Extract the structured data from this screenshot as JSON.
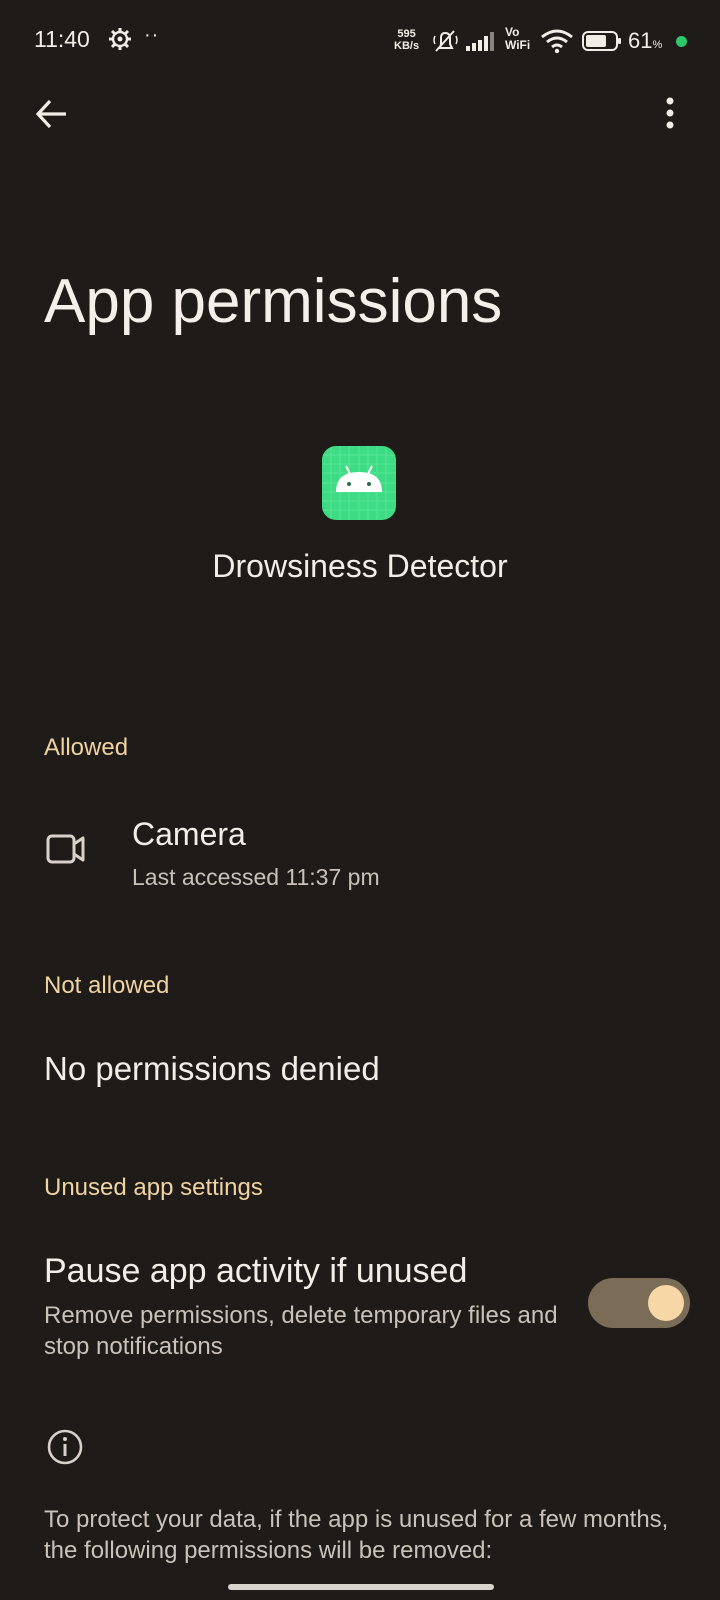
{
  "status_bar": {
    "time": "11:40",
    "net_speed_value": "595",
    "net_speed_unit": "KB/s",
    "vo_label": "Vo",
    "wifi_label": "WiFi",
    "battery_percent": "61",
    "percent_sign": "%",
    "icons": [
      "settings-gear-icon",
      "mute-icon",
      "signal-icon",
      "wifi-icon",
      "battery-icon"
    ],
    "active_dot_color": "#2ec76a"
  },
  "toolbar": {
    "back_icon": "arrow-left-icon",
    "more_icon": "more-vertical-icon"
  },
  "page": {
    "title": "App permissions"
  },
  "app": {
    "name": "Drowsiness Detector",
    "icon": "android-icon",
    "icon_color": "#3ddc84"
  },
  "sections": {
    "allowed": {
      "header": "Allowed",
      "items": [
        {
          "icon": "camera-icon",
          "title": "Camera",
          "subtitle": "Last accessed 11:37 pm"
        }
      ]
    },
    "not_allowed": {
      "header": "Not allowed",
      "empty_text": "No permissions denied"
    },
    "unused": {
      "header": "Unused app settings",
      "setting_title": "Pause app activity if unused",
      "setting_desc": "Remove permissions, delete temporary files and stop notifications",
      "toggle_on": true
    }
  },
  "info": {
    "icon": "info-icon",
    "text": "To protect your data, if the app is unused for a few months, the following permissions will be removed:"
  },
  "theme": {
    "background": "#1e1b18",
    "accent": "#f0d3a3",
    "toggle_track": "#7b6c57",
    "toggle_knob": "#f8d7a6"
  }
}
